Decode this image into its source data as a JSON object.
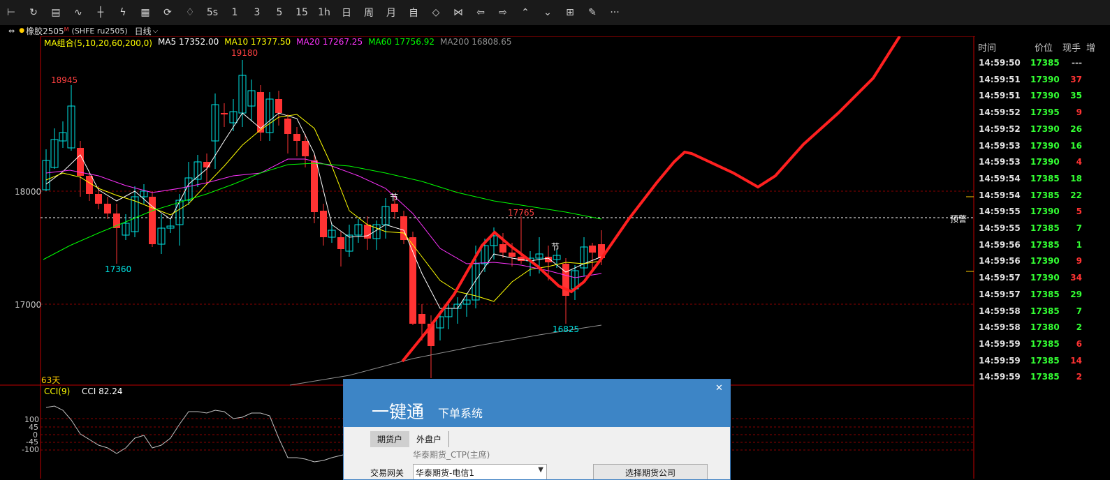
{
  "toolbar": {
    "items": [
      {
        "icon": "back-icon",
        "label": ""
      },
      {
        "icon": "refresh-icon",
        "label": ""
      },
      {
        "icon": "list-icon",
        "label": ""
      },
      {
        "icon": "line-chart-icon",
        "label": ""
      },
      {
        "icon": "candle-icon",
        "label": ""
      },
      {
        "icon": "analysis-icon",
        "label": ""
      },
      {
        "icon": "table-icon",
        "label": ""
      },
      {
        "icon": "sync-icon",
        "label": ""
      },
      {
        "icon": "bell-icon",
        "label": ""
      },
      {
        "icon": "",
        "label": "5s"
      },
      {
        "icon": "",
        "label": "1"
      },
      {
        "icon": "",
        "label": "3"
      },
      {
        "icon": "",
        "label": "5"
      },
      {
        "icon": "",
        "label": "15"
      },
      {
        "icon": "",
        "label": "1h"
      },
      {
        "icon": "",
        "label": "日"
      },
      {
        "icon": "",
        "label": "周"
      },
      {
        "icon": "",
        "label": "月"
      },
      {
        "icon": "",
        "label": "自"
      },
      {
        "icon": "zoom-in-icon",
        "label": ""
      },
      {
        "icon": "zoom-out-icon",
        "label": ""
      },
      {
        "icon": "arrow-left-icon",
        "label": ""
      },
      {
        "icon": "arrow-right-icon",
        "label": ""
      },
      {
        "icon": "chevron-up-icon",
        "label": ""
      },
      {
        "icon": "chevron-down-icon",
        "label": ""
      },
      {
        "icon": "crosshair-icon",
        "label": ""
      },
      {
        "icon": "draw-icon",
        "label": ""
      },
      {
        "icon": "more-icon",
        "label": "···"
      }
    ]
  },
  "symbol": {
    "name": "橡胶2505",
    "mark": "M",
    "code": "(SHFE ru2505)",
    "period": "日线"
  },
  "ma_legend": {
    "group": "MA组合(5,10,20,60,200,0)",
    "items": [
      {
        "label": "MA5 17352.00",
        "color": "#ffffff"
      },
      {
        "label": "MA10 17377.50",
        "color": "#ffff00"
      },
      {
        "label": "MA20 17267.25",
        "color": "#ff00ff"
      },
      {
        "label": "MA60 17756.92",
        "color": "#00ff00"
      },
      {
        "label": "MA200 16808.65",
        "color": "#909090"
      }
    ]
  },
  "price_axis": {
    "labels": [
      {
        "text": "18000",
        "value": 18000
      },
      {
        "text": "17000",
        "value": 17000
      }
    ]
  },
  "annotations": {
    "high_left": "18945",
    "high_top": "19180",
    "low_left": "17360",
    "mid_high": "17765",
    "low_right": "16825",
    "holiday": "节",
    "alert": "预警",
    "days": "63天"
  },
  "cci": {
    "title": "CCI(9)",
    "value": "CCI 82.24",
    "levels": [
      "100",
      "45",
      "0",
      "-45",
      "-100"
    ]
  },
  "ticks": {
    "headers": [
      "时间",
      "价位",
      "现手",
      "增"
    ],
    "rows": [
      {
        "time": "14:59:50",
        "price": "17385",
        "vol": "---",
        "dir": ""
      },
      {
        "time": "14:59:51",
        "price": "17390",
        "vol": "37",
        "dir": "up"
      },
      {
        "time": "14:59:51",
        "price": "17390",
        "vol": "35",
        "dir": "down"
      },
      {
        "time": "14:59:52",
        "price": "17395",
        "vol": "9",
        "dir": "up"
      },
      {
        "time": "14:59:52",
        "price": "17390",
        "vol": "26",
        "dir": "down"
      },
      {
        "time": "14:59:53",
        "price": "17390",
        "vol": "16",
        "dir": "down"
      },
      {
        "time": "14:59:53",
        "price": "17390",
        "vol": "4",
        "dir": "up"
      },
      {
        "time": "14:59:54",
        "price": "17385",
        "vol": "18",
        "dir": "down"
      },
      {
        "time": "14:59:54",
        "price": "17385",
        "vol": "22",
        "dir": "down"
      },
      {
        "time": "14:59:55",
        "price": "17390",
        "vol": "5",
        "dir": "up"
      },
      {
        "time": "14:59:55",
        "price": "17385",
        "vol": "7",
        "dir": "down"
      },
      {
        "time": "14:59:56",
        "price": "17385",
        "vol": "1",
        "dir": "down"
      },
      {
        "time": "14:59:56",
        "price": "17390",
        "vol": "9",
        "dir": "up"
      },
      {
        "time": "14:59:57",
        "price": "17390",
        "vol": "34",
        "dir": "up"
      },
      {
        "time": "14:59:57",
        "price": "17385",
        "vol": "29",
        "dir": "down"
      },
      {
        "time": "14:59:58",
        "price": "17385",
        "vol": "7",
        "dir": "down"
      },
      {
        "time": "14:59:58",
        "price": "17380",
        "vol": "2",
        "dir": "down"
      },
      {
        "time": "14:59:59",
        "price": "17385",
        "vol": "6",
        "dir": "up"
      },
      {
        "time": "14:59:59",
        "price": "17385",
        "vol": "14",
        "dir": "up"
      },
      {
        "time": "14:59:59",
        "price": "17385",
        "vol": "2",
        "dir": "up"
      }
    ]
  },
  "dialog": {
    "title": "一键通",
    "subtitle": "下单系统",
    "close": "✕",
    "tabs": [
      "期货户",
      "外盘户"
    ],
    "broker": "华泰期货_CTP(主席)",
    "gateway_label": "交易网关",
    "gateway_value": "华泰期货-电信1",
    "select_button": "选择期货公司"
  },
  "colors": {
    "up": "#ff3333",
    "down": "#00e5e5",
    "grid_red": "#8b0000",
    "axis_red": "#c00000",
    "tick_price": "#33ff33"
  }
}
